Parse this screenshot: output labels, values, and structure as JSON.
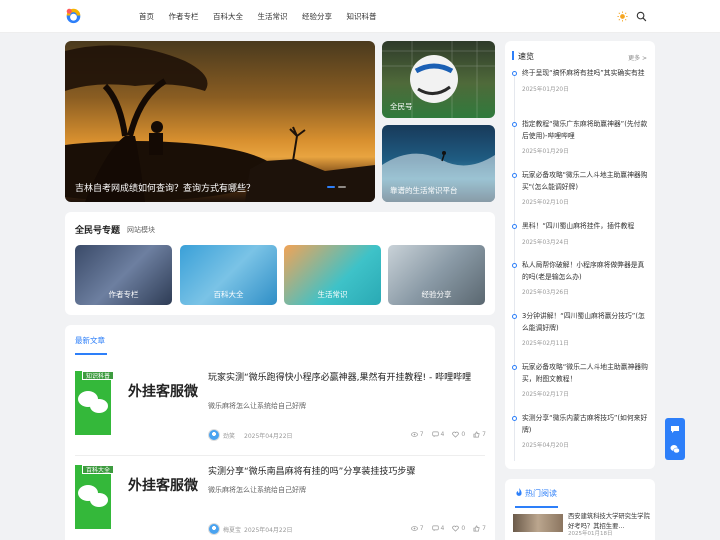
{
  "nav": [
    "首页",
    "作者专栏",
    "百科大全",
    "生活常识",
    "经验分享",
    "知识科普"
  ],
  "hero": {
    "main_title": "吉林自考网成绩如何查询？查询方式有哪些？",
    "side": [
      "全民号",
      "靠谱的生活常识平台"
    ]
  },
  "topics": {
    "title": "全民号专题",
    "subtitle": "网站模块",
    "items": [
      "作者专栏",
      "百科大全",
      "生活常识",
      "经验分享"
    ]
  },
  "articles": {
    "tab": "最新文章",
    "items": [
      {
        "tag": "知识科普",
        "thumb_text": "外挂客服微",
        "title": "玩家实测“微乐跑得快小程序必赢神器,果然有开挂教程! - 哔哩哔哩",
        "desc": "微乐麻将怎么让系统给自己好牌",
        "author": "劲笑",
        "date": "2025年04月22日",
        "views": "7",
        "comments": "4",
        "likes": "0",
        "shares": "7"
      },
      {
        "tag": "百科大全",
        "thumb_text": "外挂客服微",
        "title": "实测分享“微乐南昌麻将有挂的吗”分享装挂技巧步骤",
        "desc": "微乐麻将怎么让系统给自己好牌",
        "author": "梅夏宝",
        "date": "2025年04月22日",
        "views": "7",
        "comments": "4",
        "likes": "0",
        "shares": "7"
      }
    ]
  },
  "news": {
    "title": "速览",
    "more": "更多 >",
    "items": [
      {
        "title": "终于呈现“搞怀麻将有挂吗”其实确实有挂",
        "date": "2025年01月20日"
      },
      {
        "title": "指定教程“微乐广东麻将助赢神器”(先付款后使用)-哔哩哔哩",
        "date": "2025年01月29日"
      },
      {
        "title": "玩家必备攻略\"微乐二人斗地主助赢神器购买\"(怎么能调好牌)",
        "date": "2025年02月10日"
      },
      {
        "title": "黑科！“四川蜀山麻将挂件，插件教程",
        "date": "2025年03月24日"
      },
      {
        "title": "私人局帮你破解！小程序麻将做弊器是真的吗(老是输怎么办)",
        "date": "2025年03月26日"
      },
      {
        "title": "3分钟讲解！“四川蜀山麻将赢分技巧”(怎么能调好牌)",
        "date": "2025年02月11日"
      },
      {
        "title": "玩家必备攻略“微乐二人斗地主助赢神器购买，附图文教程！",
        "date": "2025年02月17日"
      },
      {
        "title": "实测分享“微乐内蒙古麻将技巧”(如何来好牌)",
        "date": "2025年04月20日"
      }
    ]
  },
  "hot": {
    "title": "热门阅读",
    "item_title": "西安建筑科技大学研究生学院好考吗？其招生要...",
    "item_date": "2025年01月18日"
  },
  "colors": {
    "accent": "#2d7ff9",
    "wechat": "#34b83a"
  }
}
